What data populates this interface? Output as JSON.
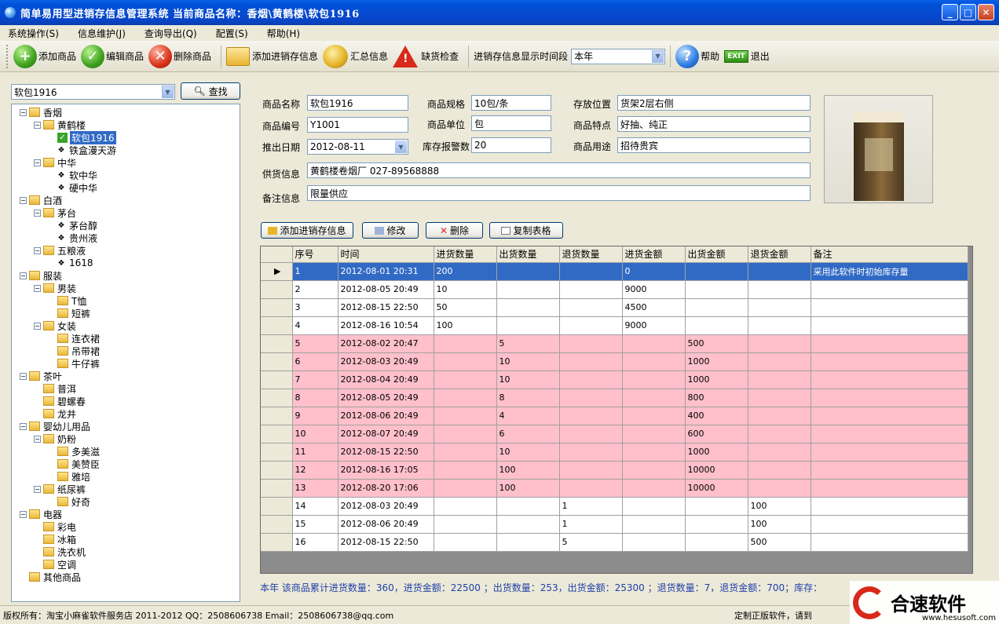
{
  "window": {
    "title": "简单易用型进销存信息管理系统   当前商品名称：香烟\\黄鹤楼\\软包1916",
    "minimize": "_",
    "maximize": "□",
    "close": "✕"
  },
  "menu": [
    "系统操作(S)",
    "信息维护(J)",
    "查询导出(Q)",
    "配置(S)",
    "帮助(H)"
  ],
  "toolbar": {
    "add_product": "添加商品",
    "edit_product": "编辑商品",
    "delete_product": "删除商品",
    "add_stock_info": "添加进销存信息",
    "summary_info": "汇总信息",
    "shortage_check": "缺货检查",
    "period_label": "进销存信息显示时间段",
    "period_value": "本年",
    "help": "帮助",
    "exit_badge": "EXIT",
    "exit": "退出"
  },
  "search": {
    "value": "软包1916",
    "find_label": "查找"
  },
  "tree": [
    {
      "label": "香烟",
      "level": 0,
      "type": "folder",
      "toggle": "−"
    },
    {
      "label": "黄鹤楼",
      "level": 1,
      "type": "folder",
      "toggle": "−"
    },
    {
      "label": "软包1916",
      "level": 2,
      "type": "checked",
      "selected": true
    },
    {
      "label": "铁盒漫天游",
      "level": 2,
      "type": "leaf"
    },
    {
      "label": "中华",
      "level": 1,
      "type": "folder",
      "toggle": "−"
    },
    {
      "label": "软中华",
      "level": 2,
      "type": "leaf"
    },
    {
      "label": "硬中华",
      "level": 2,
      "type": "leaf"
    },
    {
      "label": "白酒",
      "level": 0,
      "type": "folder",
      "toggle": "−"
    },
    {
      "label": "茅台",
      "level": 1,
      "type": "folder",
      "toggle": "−"
    },
    {
      "label": "茅台醇",
      "level": 2,
      "type": "leaf"
    },
    {
      "label": "贵州液",
      "level": 2,
      "type": "leaf"
    },
    {
      "label": "五粮液",
      "level": 1,
      "type": "folder",
      "toggle": "−"
    },
    {
      "label": "1618",
      "level": 2,
      "type": "leaf"
    },
    {
      "label": "服装",
      "level": 0,
      "type": "folder",
      "toggle": "−"
    },
    {
      "label": "男装",
      "level": 1,
      "type": "folder",
      "toggle": "−"
    },
    {
      "label": "T恤",
      "level": 2,
      "type": "folder"
    },
    {
      "label": "短裤",
      "level": 2,
      "type": "folder"
    },
    {
      "label": "女装",
      "level": 1,
      "type": "folder",
      "toggle": "−"
    },
    {
      "label": "连衣裙",
      "level": 2,
      "type": "folder"
    },
    {
      "label": "吊带裙",
      "level": 2,
      "type": "folder"
    },
    {
      "label": "牛仔裤",
      "level": 2,
      "type": "folder"
    },
    {
      "label": "茶叶",
      "level": 0,
      "type": "folder",
      "toggle": "−"
    },
    {
      "label": "普洱",
      "level": 1,
      "type": "folder"
    },
    {
      "label": "碧螺春",
      "level": 1,
      "type": "folder"
    },
    {
      "label": "龙井",
      "level": 1,
      "type": "folder"
    },
    {
      "label": "婴幼儿用品",
      "level": 0,
      "type": "folder",
      "toggle": "−"
    },
    {
      "label": "奶粉",
      "level": 1,
      "type": "folder",
      "toggle": "−"
    },
    {
      "label": "多美滋",
      "level": 2,
      "type": "folder"
    },
    {
      "label": "美赞臣",
      "level": 2,
      "type": "folder"
    },
    {
      "label": "雅培",
      "level": 2,
      "type": "folder"
    },
    {
      "label": "纸尿裤",
      "level": 1,
      "type": "folder",
      "toggle": "−"
    },
    {
      "label": "好奇",
      "level": 2,
      "type": "folder"
    },
    {
      "label": "电器",
      "level": 0,
      "type": "folder",
      "toggle": "−"
    },
    {
      "label": "彩电",
      "level": 1,
      "type": "folder"
    },
    {
      "label": "冰箱",
      "level": 1,
      "type": "folder"
    },
    {
      "label": "洗衣机",
      "level": 1,
      "type": "folder"
    },
    {
      "label": "空调",
      "level": 1,
      "type": "folder"
    },
    {
      "label": "其他商品",
      "level": 0,
      "type": "folder"
    }
  ],
  "form": {
    "name_label": "商品名称",
    "name": "软包1916",
    "spec_label": "商品规格",
    "spec": "10包/条",
    "location_label": "存放位置",
    "location": "货架2层右侧",
    "code_label": "商品编号",
    "code": "Y1001",
    "unit_label": "商品单位",
    "unit": "包",
    "feature_label": "商品特点",
    "feature": "好抽、纯正",
    "date_label": "推出日期",
    "date": "2012-08-11",
    "alert_label": "库存报警数",
    "alert": "20",
    "usage_label": "商品用途",
    "usage": "招待贵宾",
    "supplier_label": "供货信息",
    "supplier": "黄鹤楼卷烟厂   027-89568888",
    "remark_label": "备注信息",
    "remark": "限量供应"
  },
  "grid_buttons": {
    "add": "添加进销存信息",
    "edit": "修改",
    "delete": "删除",
    "copy": "复制表格"
  },
  "grid": {
    "columns": [
      "序号",
      "时间",
      "进货数量",
      "出货数量",
      "退货数量",
      "进货金额",
      "出货金额",
      "退货金额",
      "备注"
    ],
    "rows": [
      {
        "cells": [
          "1",
          "2012-08-01 20:31",
          "200",
          "",
          "",
          "0",
          "",
          "",
          "采用此软件时初始库存量"
        ],
        "style": "selected",
        "marker": "▶"
      },
      {
        "cells": [
          "2",
          "2012-08-05 20:49",
          "10",
          "",
          "",
          "9000",
          "",
          "",
          ""
        ],
        "style": "white",
        "marker": ""
      },
      {
        "cells": [
          "3",
          "2012-08-15 22:50",
          "50",
          "",
          "",
          "4500",
          "",
          "",
          ""
        ],
        "style": "white",
        "marker": ""
      },
      {
        "cells": [
          "4",
          "2012-08-16 10:54",
          "100",
          "",
          "",
          "9000",
          "",
          "",
          ""
        ],
        "style": "white",
        "marker": ""
      },
      {
        "cells": [
          "5",
          "2012-08-02 20:47",
          "",
          "5",
          "",
          "",
          "500",
          "",
          ""
        ],
        "style": "pink",
        "marker": ""
      },
      {
        "cells": [
          "6",
          "2012-08-03 20:49",
          "",
          "10",
          "",
          "",
          "1000",
          "",
          ""
        ],
        "style": "pink",
        "marker": ""
      },
      {
        "cells": [
          "7",
          "2012-08-04 20:49",
          "",
          "10",
          "",
          "",
          "1000",
          "",
          ""
        ],
        "style": "pink",
        "marker": ""
      },
      {
        "cells": [
          "8",
          "2012-08-05 20:49",
          "",
          "8",
          "",
          "",
          "800",
          "",
          ""
        ],
        "style": "pink",
        "marker": ""
      },
      {
        "cells": [
          "9",
          "2012-08-06 20:49",
          "",
          "4",
          "",
          "",
          "400",
          "",
          ""
        ],
        "style": "pink",
        "marker": ""
      },
      {
        "cells": [
          "10",
          "2012-08-07 20:49",
          "",
          "6",
          "",
          "",
          "600",
          "",
          ""
        ],
        "style": "pink",
        "marker": ""
      },
      {
        "cells": [
          "11",
          "2012-08-15 22:50",
          "",
          "10",
          "",
          "",
          "1000",
          "",
          ""
        ],
        "style": "pink",
        "marker": ""
      },
      {
        "cells": [
          "12",
          "2012-08-16 17:05",
          "",
          "100",
          "",
          "",
          "10000",
          "",
          ""
        ],
        "style": "pink",
        "marker": ""
      },
      {
        "cells": [
          "13",
          "2012-08-20 17:06",
          "",
          "100",
          "",
          "",
          "10000",
          "",
          ""
        ],
        "style": "pink",
        "marker": ""
      },
      {
        "cells": [
          "14",
          "2012-08-03 20:49",
          "",
          "",
          "1",
          "",
          "",
          "100",
          ""
        ],
        "style": "white",
        "marker": ""
      },
      {
        "cells": [
          "15",
          "2012-08-06 20:49",
          "",
          "",
          "1",
          "",
          "",
          "100",
          ""
        ],
        "style": "white",
        "marker": ""
      },
      {
        "cells": [
          "16",
          "2012-08-15 22:50",
          "",
          "",
          "5",
          "",
          "",
          "500",
          ""
        ],
        "style": "white",
        "marker": ""
      }
    ]
  },
  "summary": "本年  该商品累计进货数量：360，进货金额：22500 ；出货数量：253，出货金额：25300 ；退货数量：7，退货金额：700；库存：",
  "status": {
    "left": "版权所有：淘宝小麻雀软件服务店 2011-2012    QQ：2508606738    Email：2508606738@qq.com",
    "right": "定制正版软件，请到"
  },
  "watermark": {
    "text": "合速软件",
    "url": "www.hesusoft.com"
  },
  "colors": {
    "pink_row": "#FFC0CB",
    "selected_row": "#316AC5",
    "title_bar": "#0845C8"
  }
}
